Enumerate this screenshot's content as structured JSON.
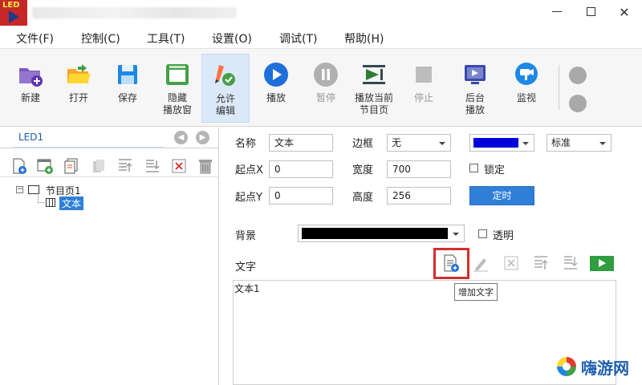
{
  "app": {
    "logo_text": "LED",
    "window_controls": {
      "minimize_icon": "minimize-icon",
      "maximize_icon": "maximize-icon",
      "close_label": "✕"
    }
  },
  "menu": {
    "items": [
      "文件(F)",
      "控制(C)",
      "工具(T)",
      "设置(O)",
      "调试(T)",
      "帮助(H)"
    ]
  },
  "toolbar": {
    "buttons": [
      {
        "label": "新建",
        "icon": "new-folder-icon",
        "enabled": true
      },
      {
        "label": "打开",
        "icon": "open-folder-icon",
        "enabled": true
      },
      {
        "label": "保存",
        "icon": "save-icon",
        "enabled": true
      },
      {
        "label": "隐藏\n播放窗",
        "icon": "hide-window-icon",
        "enabled": true
      },
      {
        "label": "允许\n编辑",
        "icon": "allow-edit-icon",
        "enabled": true,
        "active": true
      },
      {
        "label": "播放",
        "icon": "play-icon",
        "enabled": true
      },
      {
        "label": "暂停",
        "icon": "pause-icon",
        "enabled": false
      },
      {
        "label": "播放当前\n节目页",
        "icon": "play-current-page-icon",
        "enabled": true
      },
      {
        "label": "停止",
        "icon": "stop-icon",
        "enabled": false
      },
      {
        "label": "后台\n播放",
        "icon": "background-play-icon",
        "enabled": true
      },
      {
        "label": "监视",
        "icon": "monitor-icon",
        "enabled": true
      }
    ]
  },
  "left_panel": {
    "tab_label": "LED1",
    "tree": {
      "page_label": "节目页1",
      "child_label": "文本"
    }
  },
  "properties": {
    "name_label": "名称",
    "name_value": "文本",
    "border_label": "边框",
    "border_value": "无",
    "color_value": "#0000d8",
    "mode_value": "标准",
    "start_x_label": "起点X",
    "start_x_value": "0",
    "width_label": "宽度",
    "width_value": "700",
    "lock_label": "锁定",
    "start_y_label": "起点Y",
    "start_y_value": "0",
    "height_label": "高度",
    "height_value": "256",
    "timer_button": "定时",
    "background_label": "背景",
    "background_color": "#000000",
    "transparent_label": "透明",
    "text_label": "文字",
    "text_content": "文本1",
    "tooltip": "增加文字"
  },
  "watermark": {
    "text": "嗨游网"
  },
  "colors": {
    "accent": "#2f7fd9",
    "highlight": "#d32f2f",
    "logo_bg": "#c62828"
  }
}
